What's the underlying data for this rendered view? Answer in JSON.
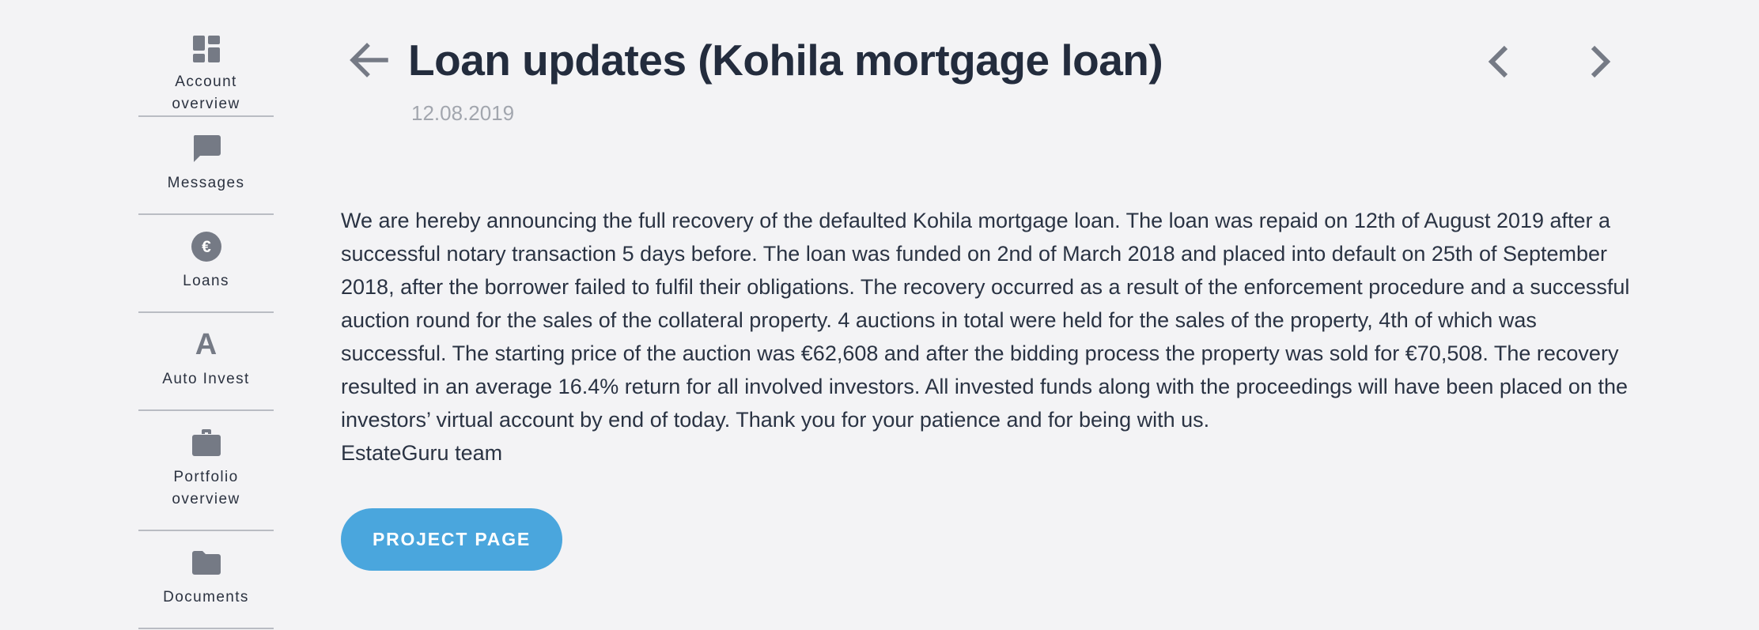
{
  "sidebar": {
    "items": [
      {
        "label": "Account overview",
        "icon": "dashboard-icon"
      },
      {
        "label": "Messages",
        "icon": "message-icon"
      },
      {
        "label": "Loans",
        "icon": "euro-coin-icon",
        "glyph": "€"
      },
      {
        "label": "Auto Invest",
        "icon": "auto-invest-icon",
        "glyph": "A"
      },
      {
        "label": "Portfolio overview",
        "icon": "briefcase-icon"
      },
      {
        "label": "Documents",
        "icon": "folder-icon"
      }
    ]
  },
  "header": {
    "title": "Loan updates (Kohila mortgage loan)",
    "date": "12.08.2019",
    "back_icon": "arrow-left-icon",
    "prev_icon": "chevron-left-icon",
    "next_icon": "chevron-right-icon"
  },
  "article": {
    "body": "We are hereby announcing the full recovery of the defaulted Kohila mortgage loan. The loan was repaid on 12th of August 2019 after a successful notary transaction 5 days before. The loan was funded on 2nd of March 2018 and placed into default on 25th of September 2018, after the borrower failed to fulfil their obligations. The recovery occurred as a result of the enforcement procedure and a successful auction round for the sales of the collateral property. 4 auctions in total were held for the sales of the property, 4th of which was successful. The starting price of the auction was €62,608 and after the bidding process the property was sold for €70,508. The recovery resulted in an average 16.4% return for all involved investors. All invested funds along with the proceedings will have been placed on the investors’ virtual account by end of today. Thank you for your patience and for being with us.",
    "signature": "EstateGuru team"
  },
  "actions": {
    "project_button": "PROJECT PAGE"
  },
  "colors": {
    "background": "#f3f3f5",
    "icon_gray": "#757a85",
    "accent_blue": "#4aa6dd",
    "title_text": "#232c3d",
    "date_text": "#a2a6ae"
  }
}
